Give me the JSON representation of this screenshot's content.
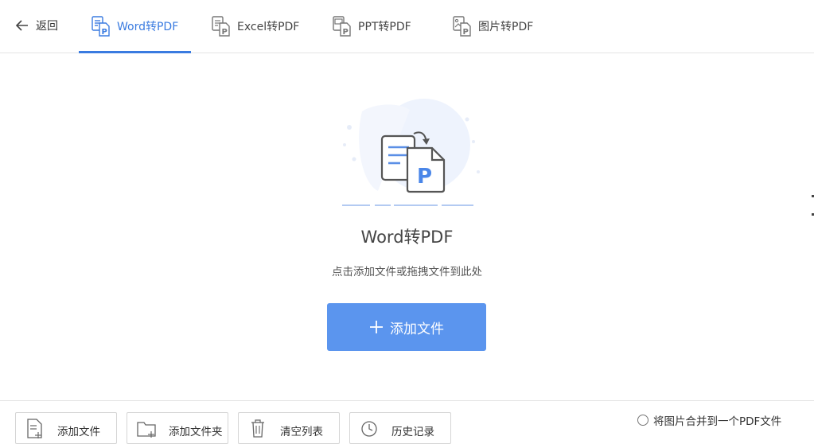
{
  "nav": {
    "back_label": "返回",
    "tabs": [
      {
        "label": "Word转PDF",
        "active": true,
        "icon": "word-to-pdf-icon"
      },
      {
        "label": "Excel转PDF",
        "active": false,
        "icon": "excel-to-pdf-icon"
      },
      {
        "label": "PPT转PDF",
        "active": false,
        "icon": "ppt-to-pdf-icon"
      },
      {
        "label": "图片转PDF",
        "active": false,
        "icon": "image-to-pdf-icon"
      }
    ]
  },
  "main": {
    "title": "Word转PDF",
    "hint": "点击添加文件或拖拽文件到此处",
    "add_button_label": "添加文件"
  },
  "footer": {
    "buttons": [
      {
        "label": "添加文件",
        "icon": "add-file-icon"
      },
      {
        "label": "添加文件夹",
        "icon": "add-folder-icon"
      },
      {
        "label": "清空列表",
        "icon": "trash-icon"
      },
      {
        "label": "历史记录",
        "icon": "clock-icon"
      }
    ],
    "merge_option_label": "将图片合并到一个PDF文件"
  },
  "colors": {
    "accent": "#3a7be0",
    "button": "#5b95ee",
    "border": "#e4e4e4"
  }
}
